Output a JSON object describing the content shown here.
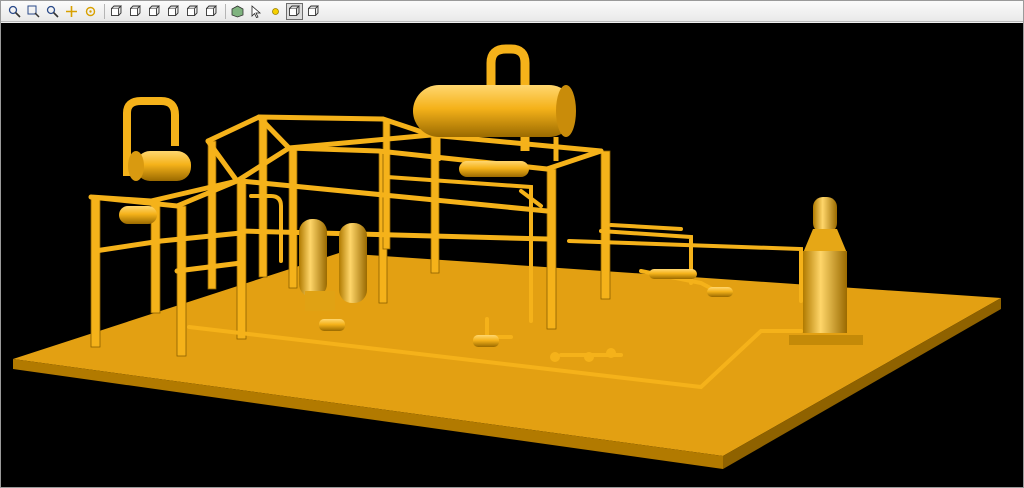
{
  "window": {
    "background": "#000000"
  },
  "toolbar": {
    "buttons": [
      {
        "name": "zoom-window-icon",
        "kind": "zoom"
      },
      {
        "name": "zoom-fit-icon",
        "kind": "zoom-box"
      },
      {
        "name": "zoom-dynamic-icon",
        "kind": "zoom"
      },
      {
        "name": "pan-icon",
        "kind": "pan"
      },
      {
        "name": "rotate-icon",
        "kind": "rotate"
      },
      {
        "name": "view-front-icon",
        "kind": "cube"
      },
      {
        "name": "view-back-icon",
        "kind": "cube"
      },
      {
        "name": "view-top-icon",
        "kind": "cube"
      },
      {
        "name": "view-bottom-icon",
        "kind": "cube"
      },
      {
        "name": "view-left-icon",
        "kind": "cube"
      },
      {
        "name": "view-right-icon",
        "kind": "cube"
      },
      {
        "name": "view-iso-icon",
        "kind": "iso"
      },
      {
        "name": "select-icon",
        "kind": "select"
      },
      {
        "name": "light-icon",
        "kind": "light"
      },
      {
        "name": "shaded-mode-icon",
        "kind": "cube",
        "active": true
      },
      {
        "name": "wireframe-mode-icon",
        "kind": "cube"
      }
    ]
  },
  "model": {
    "name": "process-plant-skid",
    "color": "#f5b21a",
    "shadow": "#8a5f00",
    "highlight": "#ffd770"
  }
}
